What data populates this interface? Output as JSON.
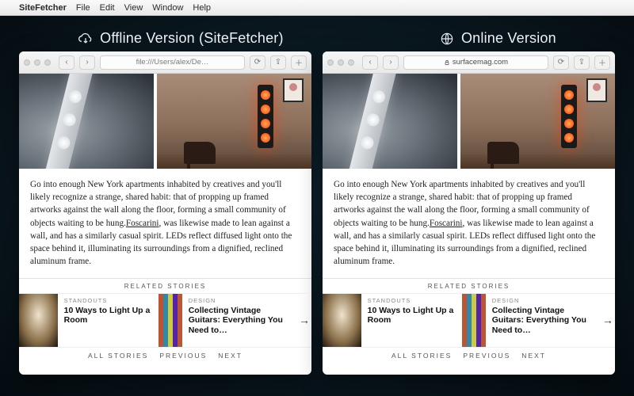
{
  "menubar": {
    "app": "SiteFetcher",
    "items": [
      "File",
      "Edit",
      "View",
      "Window",
      "Help"
    ]
  },
  "headings": {
    "offline": "Offline Version (SiteFetcher)",
    "online": "Online Version"
  },
  "browser": {
    "offline_url": "file:///Users/alex/De…",
    "online_url": "surfacemag.com"
  },
  "article": {
    "body_pre": "Go into enough New York apartments inhabited by creatives and you'll likely recognize a strange, shared habit: that of propping up framed artworks against the wall along the floor, forming a small community of objects waiting to be hung.",
    "link": "Foscarini",
    "body_post": ", was likewise made to lean against a wall, and has a similarly casual spirit. LEDs reflect diffused light onto the space behind it, illuminating its surroundings from a dignified, reclined aluminum frame."
  },
  "related": {
    "heading": "RELATED STORIES",
    "cards": [
      {
        "eyebrow": "STANDOUTS",
        "title": "10 Ways to Light Up a Room"
      },
      {
        "eyebrow": "DESIGN",
        "title": "Collecting Vintage Guitars: Everything You Need to…"
      }
    ],
    "pager": [
      "ALL STORIES",
      "PREVIOUS",
      "NEXT"
    ]
  }
}
